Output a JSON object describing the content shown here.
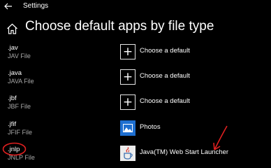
{
  "window": {
    "title": "Settings"
  },
  "header": {
    "title": "Choose default apps by file type"
  },
  "rows": [
    {
      "ext": ".jav",
      "type": "JAV File",
      "app": "Choose a default",
      "icon": "plus-icon"
    },
    {
      "ext": ".java",
      "type": "JAVA File",
      "app": "Choose a default",
      "icon": "plus-icon"
    },
    {
      "ext": ".jbf",
      "type": "JBF File",
      "app": "Choose a default",
      "icon": "plus-icon"
    },
    {
      "ext": ".jfif",
      "type": "JFIF File",
      "app": "Photos",
      "icon": "photos-icon"
    },
    {
      "ext": ".jnlp",
      "type": "JNLP File",
      "app": "Java(TM) Web Start Launcher",
      "icon": "java-icon"
    }
  ],
  "annotations": {
    "color": "#e02020"
  },
  "colors": {
    "background": "#000000",
    "text": "#ffffff",
    "secondary_text": "#a8a8a8",
    "photos_blue": "#1e6fd0"
  }
}
